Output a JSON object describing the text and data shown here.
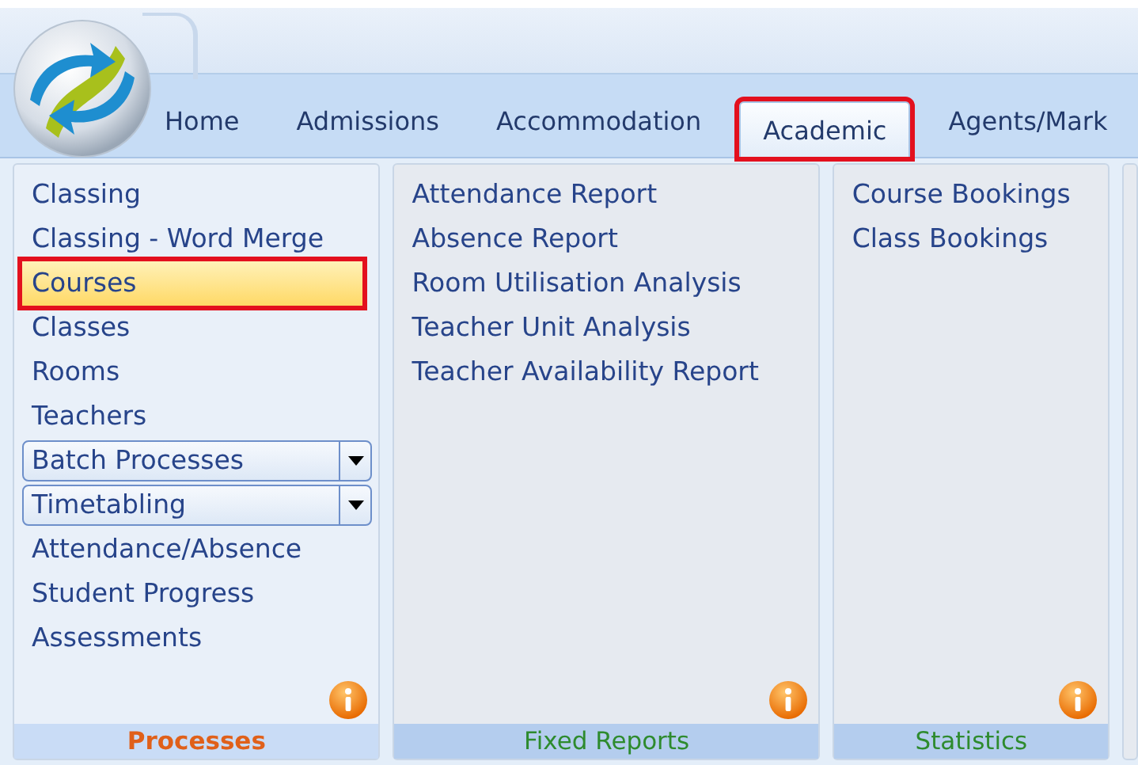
{
  "tabs": [
    {
      "label": "Home",
      "selected": false,
      "annotated": false
    },
    {
      "label": "Admissions",
      "selected": false,
      "annotated": false
    },
    {
      "label": "Accommodation",
      "selected": false,
      "annotated": false
    },
    {
      "label": "Academic",
      "selected": true,
      "annotated": true
    },
    {
      "label": "Agents/Mark",
      "selected": false,
      "annotated": false
    }
  ],
  "groups": [
    {
      "title": "Processes",
      "color": "#e0601a",
      "items": [
        {
          "kind": "link",
          "label": "Classing",
          "selected": false,
          "annotated": false
        },
        {
          "kind": "link",
          "label": "Classing - Word Merge",
          "selected": false,
          "annotated": false
        },
        {
          "kind": "link",
          "label": "Courses",
          "selected": true,
          "annotated": true
        },
        {
          "kind": "link",
          "label": "Classes",
          "selected": false,
          "annotated": false
        },
        {
          "kind": "link",
          "label": "Rooms",
          "selected": false,
          "annotated": false
        },
        {
          "kind": "link",
          "label": "Teachers",
          "selected": false,
          "annotated": false
        },
        {
          "kind": "dropdown",
          "label": "Batch Processes",
          "selected": false,
          "annotated": false
        },
        {
          "kind": "dropdown",
          "label": "Timetabling",
          "selected": false,
          "annotated": false
        },
        {
          "kind": "link",
          "label": "Attendance/Absence",
          "selected": false,
          "annotated": false
        },
        {
          "kind": "link",
          "label": "Student Progress",
          "selected": false,
          "annotated": false
        },
        {
          "kind": "link",
          "label": "Assessments",
          "selected": false,
          "annotated": false
        }
      ]
    },
    {
      "title": "Fixed Reports",
      "color": "#2e8b2e",
      "items": [
        {
          "kind": "link",
          "label": "Attendance Report",
          "selected": false,
          "annotated": false
        },
        {
          "kind": "link",
          "label": "Absence Report",
          "selected": false,
          "annotated": false
        },
        {
          "kind": "link",
          "label": "Room Utilisation Analysis",
          "selected": false,
          "annotated": false
        },
        {
          "kind": "link",
          "label": "Teacher Unit Analysis",
          "selected": false,
          "annotated": false
        },
        {
          "kind": "link",
          "label": "Teacher Availability Report",
          "selected": false,
          "annotated": false
        }
      ]
    },
    {
      "title": "Statistics",
      "color": "#2e8b2e",
      "items": [
        {
          "kind": "link",
          "label": "Course Bookings",
          "selected": false,
          "annotated": false
        },
        {
          "kind": "link",
          "label": "Class Bookings",
          "selected": false,
          "annotated": false
        }
      ]
    }
  ]
}
